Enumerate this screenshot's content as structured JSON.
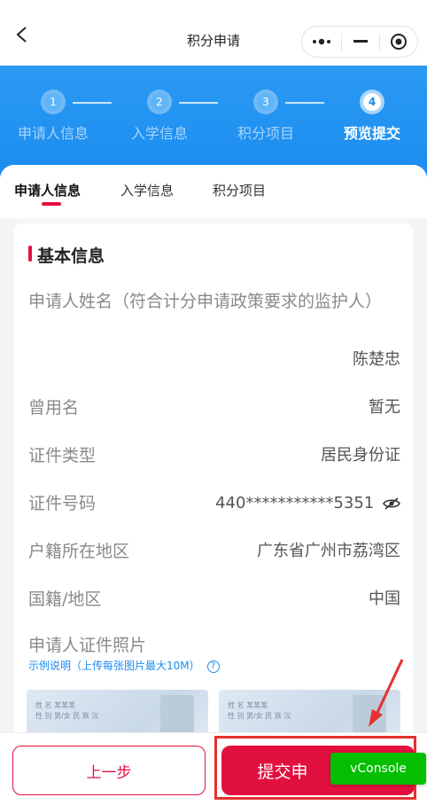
{
  "nav": {
    "title": "积分申请"
  },
  "steps": [
    {
      "num": "1",
      "label": "申请人信息"
    },
    {
      "num": "2",
      "label": "入学信息"
    },
    {
      "num": "3",
      "label": "积分项目"
    },
    {
      "num": "4",
      "label": "预览提交"
    }
  ],
  "tabs": [
    "申请人信息",
    "入学信息",
    "积分项目"
  ],
  "section": {
    "title": "基本信息"
  },
  "fields": {
    "guardian_name_label": "申请人姓名（符合计分申请政策要求的监护人）",
    "guardian_name_value": "陈楚忠",
    "former_name_label": "曾用名",
    "former_name_value": "暂无",
    "id_type_label": "证件类型",
    "id_type_value": "居民身份证",
    "id_number_label": "证件号码",
    "id_number_value": "440***********5351",
    "household_label": "户籍所在地区",
    "household_value": "广东省广州市荔湾区",
    "nationality_label": "国籍/地区",
    "nationality_value": "中国",
    "photo_label": "申请人证件照片",
    "photo_hint": "示例说明（上传每张图片最大10M）",
    "help_glyph": "?"
  },
  "photo_card_text": {
    "line1": "姓 名  某某某",
    "line2": "性 别  男/女   民 族  汉"
  },
  "buttons": {
    "prev": "上一步",
    "submit": "提交申",
    "vconsole": "vConsole"
  },
  "colors": {
    "brand_blue": "#1a8cf0",
    "accent_red": "#e2103e",
    "vconsole_green": "#04be02"
  }
}
